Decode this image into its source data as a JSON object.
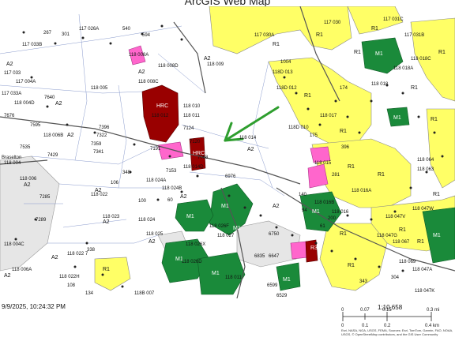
{
  "title": "ArcGIS Web Map",
  "footer": {
    "date": "9/9/2025, 10:24:32 PM",
    "scale_ratio": "1:10,658",
    "scale_mi": [
      "0",
      "0.07",
      "0.15",
      "0.3 mi"
    ],
    "scale_km": [
      "0",
      "0.1",
      "0.2",
      "0.4 km"
    ],
    "credits": "Esri, NASA, NGA, USGS, FEMA, Sources: Esri, TomTom, Garmin, FAO, NOAA, USGS, © OpenStreetMap contributors, and the GIS User Community"
  },
  "colors": {
    "a2_bg": "#ffffff",
    "r1_yellow": "#ffff66",
    "city_gray": "#e6e6e6",
    "commercial_red": "#990000",
    "mixed_pink": "#ff66cc",
    "dark_green": "#1a8a3a",
    "arrow_green": "#2e9e2e"
  },
  "labels": [
    {
      "t": "117 033B"
    },
    {
      "t": "117 026A"
    },
    {
      "t": "301"
    },
    {
      "t": "267"
    },
    {
      "t": "540"
    },
    {
      "t": "594"
    },
    {
      "t": "117 033"
    },
    {
      "t": "117 004A"
    },
    {
      "t": "117 033A"
    },
    {
      "t": "118 004D"
    },
    {
      "t": "7640"
    },
    {
      "t": "7676"
    },
    {
      "t": "7595"
    },
    {
      "t": "118 005"
    },
    {
      "t": "118 008C"
    },
    {
      "t": "118 008A"
    },
    {
      "t": "118 008D"
    },
    {
      "t": "118 009"
    },
    {
      "t": "118 010"
    },
    {
      "t": "118 011"
    },
    {
      "t": "7124"
    },
    {
      "t": "7396"
    },
    {
      "t": "7322"
    },
    {
      "t": "7359"
    },
    {
      "t": "118 006B"
    },
    {
      "t": "7535"
    },
    {
      "t": "Braselton"
    },
    {
      "t": "118 004"
    },
    {
      "t": "7429"
    },
    {
      "t": "7341"
    },
    {
      "t": "118 006"
    },
    {
      "t": "7285"
    },
    {
      "t": "118 012"
    },
    {
      "t": "7120"
    },
    {
      "t": "7068"
    },
    {
      "t": "7153"
    },
    {
      "t": "7191"
    },
    {
      "t": "348"
    },
    {
      "t": "106"
    },
    {
      "t": "118 024A"
    },
    {
      "t": "118 024B"
    },
    {
      "t": "118 022"
    },
    {
      "t": "6976"
    },
    {
      "t": "118 014D"
    },
    {
      "t": "118 014"
    },
    {
      "t": "118 023"
    },
    {
      "t": "118 024"
    },
    {
      "t": "7289"
    },
    {
      "t": "118 004C"
    },
    {
      "t": "118 006A"
    },
    {
      "t": "338"
    },
    {
      "t": "118 025"
    },
    {
      "t": "118 022 7"
    },
    {
      "t": "118 022H"
    },
    {
      "t": "118 026X"
    },
    {
      "t": "118 026D"
    },
    {
      "t": "118 015"
    },
    {
      "t": "118 016A"
    },
    {
      "t": "118 016B"
    },
    {
      "t": "118 016"
    },
    {
      "t": "118 017"
    },
    {
      "t": "118 018"
    },
    {
      "t": "118D 013"
    },
    {
      "t": "118D 012"
    },
    {
      "t": "118D 010"
    },
    {
      "t": "117 030A"
    },
    {
      "t": "117 030"
    },
    {
      "t": "117 031C"
    },
    {
      "t": "117 031B"
    },
    {
      "t": "1004"
    },
    {
      "t": "118 018C"
    },
    {
      "t": "118 018A"
    },
    {
      "t": "118 064"
    },
    {
      "t": "118 063"
    },
    {
      "t": "118 047V"
    },
    {
      "t": "118 047W"
    },
    {
      "t": "118 047G"
    },
    {
      "t": "118 067"
    },
    {
      "t": "118 069"
    },
    {
      "t": "118 047A"
    },
    {
      "t": "118 047K"
    },
    {
      "t": "118 026F"
    },
    {
      "t": "118 027"
    },
    {
      "t": "6750"
    },
    {
      "t": "6835"
    },
    {
      "t": "6647"
    },
    {
      "t": "6599"
    },
    {
      "t": "6529"
    },
    {
      "t": "118 011"
    },
    {
      "t": "118B 007"
    },
    {
      "t": "108"
    },
    {
      "t": "134"
    },
    {
      "t": "174"
    },
    {
      "t": "175"
    },
    {
      "t": "396"
    },
    {
      "t": "304"
    },
    {
      "t": "343"
    },
    {
      "t": "281"
    },
    {
      "t": "140"
    },
    {
      "t": "200"
    },
    {
      "t": "94"
    },
    {
      "t": "61"
    },
    {
      "t": "60"
    },
    {
      "t": "100"
    }
  ],
  "zones": [
    "A2",
    "A2",
    "A2",
    "A2",
    "A2",
    "A2",
    "A2",
    "A2",
    "A2",
    "A2",
    "A2",
    "A2",
    "A2",
    "A2",
    "R1",
    "R1",
    "R1",
    "R1",
    "R1",
    "R1",
    "R1",
    "R1",
    "R1",
    "R1",
    "R1",
    "R1",
    "R1",
    "R1",
    "R1",
    "R1",
    "R1"
  ],
  "codes": [
    "HRC",
    "HRC",
    "M1",
    "M1",
    "M1",
    "M1",
    "M1",
    "M1",
    "M1",
    "M1",
    "M1",
    "M1",
    "R3"
  ]
}
